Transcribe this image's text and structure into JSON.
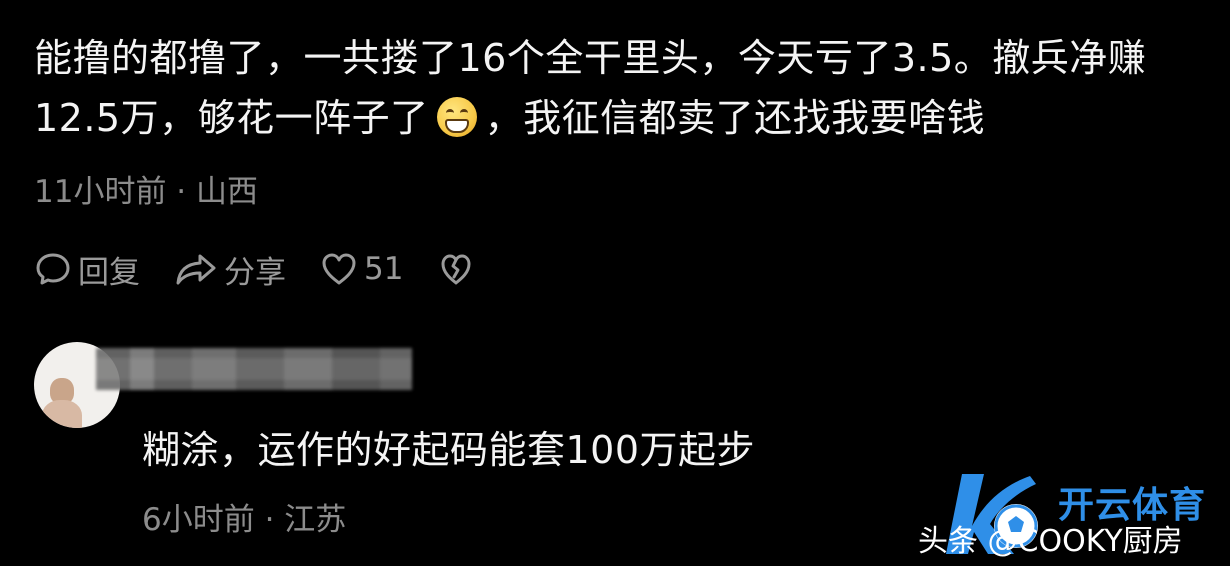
{
  "comment": {
    "text_before_emoji": "能撸的都撸了，一共搂了16个全干里头，今天亏了3.5。撤兵净赚12.5万，够花一阵子了",
    "text_after_emoji": "，我征信都卖了还找我要啥钱",
    "emoji_icon": "grinning-face-icon",
    "meta": "11小时前 · 山西",
    "actions": {
      "reply_label": "回复",
      "share_label": "分享",
      "like_count": "51"
    }
  },
  "reply": {
    "text": "糊涂，运作的好起码能套100万起步",
    "meta": "6小时前 · 江苏"
  },
  "watermark": {
    "brand": "开云体育",
    "source": "头条 @COOKY厨房"
  },
  "colors": {
    "background": "#000000",
    "text": "#f4f4f4",
    "meta": "#8c8c8c",
    "watermark_blue": "#2f8fe8"
  }
}
